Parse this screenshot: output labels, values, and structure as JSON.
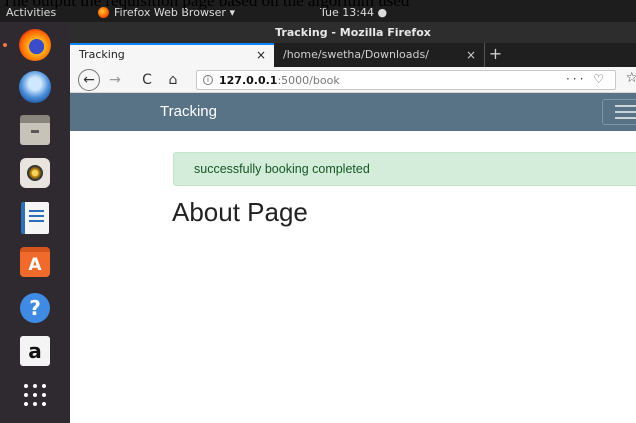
{
  "caption": {
    "text": "The output the requisition page based on the algorithm used"
  },
  "topbar": {
    "activities": "Activities",
    "app_menu": "Firefox Web Browser ▾",
    "clock": "Tue 13:44 ●"
  },
  "dock": {
    "items": [
      {
        "icon": "firefox-icon"
      },
      {
        "icon": "thunderbird-icon"
      },
      {
        "icon": "files-icon"
      },
      {
        "icon": "rhythmbox-icon"
      },
      {
        "icon": "libreoffice-writer-icon"
      },
      {
        "icon": "software-center-icon",
        "glyph": "A"
      },
      {
        "icon": "help-icon",
        "glyph": "?"
      },
      {
        "icon": "amazon-icon",
        "glyph": "a"
      },
      {
        "icon": "show-apps-icon"
      }
    ]
  },
  "browser": {
    "window_title": "Tracking - Mozilla Firefox",
    "tabs": [
      {
        "label": "Tracking",
        "active": true
      },
      {
        "label": "/home/swetha/Downloads/",
        "active": false
      }
    ],
    "tab_close": "×",
    "new_tab": "+",
    "nav": {
      "back": "←",
      "forward": "→",
      "reload": "C",
      "home": "⌂"
    },
    "url": {
      "info": "i",
      "host": "127.0.0.1",
      "path": ":5000/book",
      "actions": "··· ♡",
      "bookmark": "☆"
    }
  },
  "page": {
    "brand": "Tracking",
    "alert": "successfully booking completed",
    "heading": "About Page"
  },
  "colors": {
    "navbar": "#587386",
    "alert_bg": "#d4edda",
    "alert_text": "#155724",
    "dock_bg": "#2e2a30",
    "topbar_bg": "#1d1d1d"
  }
}
